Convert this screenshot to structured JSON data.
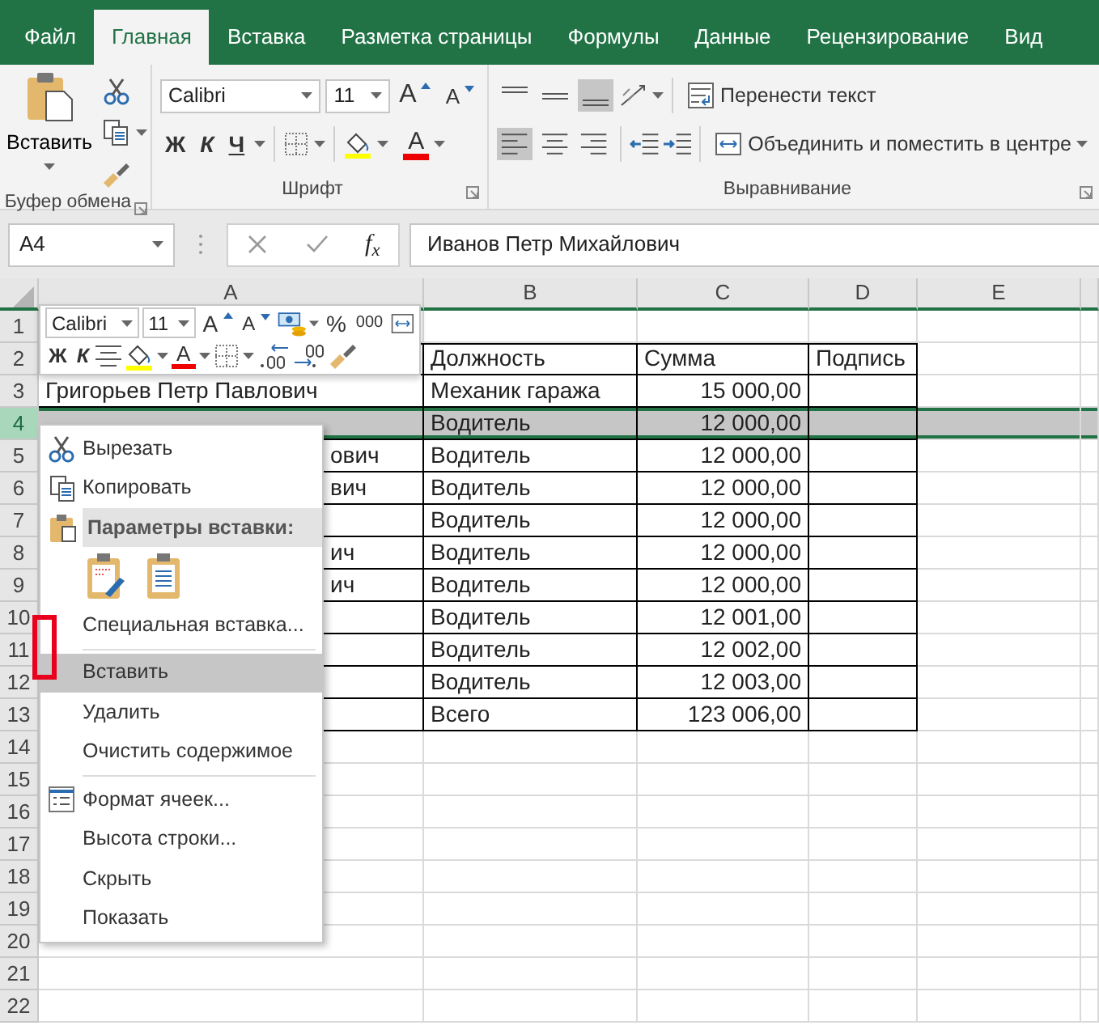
{
  "tabs": [
    {
      "label": "Файл",
      "selected": false
    },
    {
      "label": "Главная",
      "selected": true
    },
    {
      "label": "Вставка",
      "selected": false
    },
    {
      "label": "Разметка страницы",
      "selected": false
    },
    {
      "label": "Формулы",
      "selected": false
    },
    {
      "label": "Данные",
      "selected": false
    },
    {
      "label": "Рецензирование",
      "selected": false
    },
    {
      "label": "Вид",
      "selected": false
    }
  ],
  "ribbon": {
    "clipboard": {
      "paste": "Вставить",
      "caption": "Буфер обмена"
    },
    "font": {
      "font_name": "Calibri",
      "font_size": "11",
      "grow": "A",
      "shrink": "A",
      "bold": "Ж",
      "italic": "К",
      "underline": "Ч",
      "font_color": "A",
      "caption": "Шрифт"
    },
    "alignment": {
      "vertical": [
        {
          "selected": false
        },
        {
          "selected": false
        },
        {
          "selected": true
        }
      ],
      "horizontal": [
        {
          "selected": true
        },
        {
          "selected": false
        },
        {
          "selected": false
        }
      ],
      "wrap": "Перенести текст",
      "merge": "Объединить и поместить в центре",
      "caption": "Выравнивание"
    }
  },
  "formula_bar": {
    "name_box": "A4",
    "fx": "f$_{x}$",
    "value": "Иванов Петр Михайлович"
  },
  "sheet": {
    "columns": [
      "A",
      "B",
      "C",
      "D",
      "E"
    ],
    "rows": [
      {
        "number": "1",
        "selected": false,
        "bordered": false
      },
      {
        "number": "2",
        "selected": false,
        "bordered": true,
        "cells": {
          "b": "Должность",
          "c": "Сумма",
          "d": "Подпись"
        }
      },
      {
        "number": "3",
        "selected": false,
        "bordered": true,
        "cells": {
          "a": "Григорьев Петр Павлович",
          "b": "Механик гаража",
          "c": "15 000,00"
        }
      },
      {
        "number": "4",
        "selected": true,
        "bordered": true,
        "cells": {
          "b": "Водитель",
          "c": "12 000,00"
        }
      },
      {
        "number": "5",
        "selected": false,
        "bordered": true,
        "cells": {
          "a": "ович",
          "b": "Водитель",
          "c": "12 000,00"
        }
      },
      {
        "number": "6",
        "selected": false,
        "bordered": true,
        "cells": {
          "a": "вич",
          "b": "Водитель",
          "c": "12 000,00"
        }
      },
      {
        "number": "7",
        "selected": false,
        "bordered": true,
        "cells": {
          "b": "Водитель",
          "c": "12 000,00"
        }
      },
      {
        "number": "8",
        "selected": false,
        "bordered": true,
        "cells": {
          "a": "ич",
          "b": "Водитель",
          "c": "12 000,00"
        }
      },
      {
        "number": "9",
        "selected": false,
        "bordered": true,
        "cells": {
          "a": "ич",
          "b": "Водитель",
          "c": "12 000,00"
        }
      },
      {
        "number": "10",
        "selected": false,
        "bordered": true,
        "cells": {
          "b": "Водитель",
          "c": "12 001,00"
        }
      },
      {
        "number": "11",
        "selected": false,
        "bordered": true,
        "cells": {
          "b": "Водитель",
          "c": "12 002,00"
        }
      },
      {
        "number": "12",
        "selected": false,
        "bordered": true,
        "cells": {
          "b": "Водитель",
          "c": "12 003,00"
        }
      },
      {
        "number": "13",
        "selected": false,
        "bordered": true,
        "cells": {
          "b": "Всего",
          "c": "123 006,00"
        }
      },
      {
        "number": "14",
        "selected": false,
        "bordered": false
      },
      {
        "number": "15",
        "selected": false,
        "bordered": false
      },
      {
        "number": "16",
        "selected": false,
        "bordered": false
      },
      {
        "number": "17",
        "selected": false,
        "bordered": false
      },
      {
        "number": "18",
        "selected": false,
        "bordered": false
      },
      {
        "number": "19",
        "selected": false,
        "bordered": false
      },
      {
        "number": "20",
        "selected": false,
        "bordered": false
      },
      {
        "number": "21",
        "selected": false,
        "bordered": false
      },
      {
        "number": "22",
        "selected": false,
        "bordered": false
      }
    ]
  },
  "mini_toolbar": {
    "font_name": "Calibri",
    "font_size": "11",
    "grow": "A",
    "shrink": "A",
    "percent": "%",
    "thousands": "000",
    "bold": "Ж",
    "italic": "К",
    "font_color": "A"
  },
  "context_menu": {
    "items": [
      {
        "kind": "cut",
        "label": "Вырезать",
        "selected": false
      },
      {
        "kind": "copy",
        "label": "Копировать",
        "selected": false
      },
      {
        "kind": "paste-header",
        "label": "Параметры вставки:"
      },
      {
        "kind": "paste-options"
      },
      {
        "kind": "item",
        "label": "Специальная вставка...",
        "selected": false
      },
      {
        "kind": "separator"
      },
      {
        "kind": "item",
        "label": "Вставить",
        "selected": true
      },
      {
        "kind": "item",
        "label": "Удалить",
        "selected": false
      },
      {
        "kind": "item",
        "label": "Очистить содержимое",
        "selected": false
      },
      {
        "kind": "separator"
      },
      {
        "kind": "format-cells",
        "label": "Формат ячеек...",
        "selected": false
      },
      {
        "kind": "item",
        "label": "Высота строки...",
        "selected": false
      },
      {
        "kind": "item",
        "label": "Скрыть",
        "selected": false
      },
      {
        "kind": "item",
        "label": "Показать",
        "selected": false
      }
    ]
  },
  "annotation": {
    "kind": "frame"
  }
}
